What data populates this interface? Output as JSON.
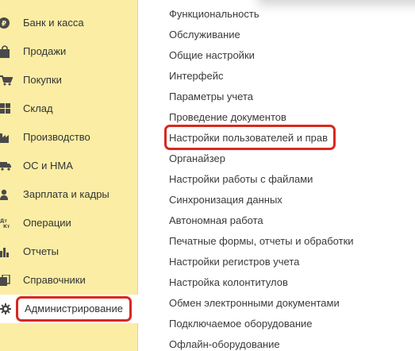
{
  "sidebar": {
    "items": [
      {
        "label": "Банк и касса",
        "icon": "coin-ruble-icon"
      },
      {
        "label": "Продажи",
        "icon": "shopping-bag-icon"
      },
      {
        "label": "Покупки",
        "icon": "shopping-cart-icon"
      },
      {
        "label": "Склад",
        "icon": "warehouse-grid-icon"
      },
      {
        "label": "Производство",
        "icon": "factory-icon"
      },
      {
        "label": "ОС и НМА",
        "icon": "truck-icon"
      },
      {
        "label": "Зарплата и кадры",
        "icon": "person-icon"
      },
      {
        "label": "Операции",
        "icon": "debit-credit-icon"
      },
      {
        "label": "Отчеты",
        "icon": "bar-chart-icon"
      },
      {
        "label": "Справочники",
        "icon": "books-icon"
      },
      {
        "label": "Администрирование",
        "icon": "gear-icon"
      }
    ],
    "active_label": "Администрирование"
  },
  "admin_menu": {
    "links": [
      "Функциональность",
      "Обслуживание",
      "Общие настройки",
      "Интерфейс",
      "Параметры учета",
      "Проведение документов",
      "Настройки пользователей и прав",
      "Органайзер",
      "Настройки работы с файлами",
      "Синхронизация данных",
      "Автономная работа",
      "Печатные формы, отчеты и обработки",
      "Настройки регистров учета",
      "Настройка колонтитулов",
      "Обмен электронными документами",
      "Подключаемое оборудование",
      "Офлайн-оборудование"
    ],
    "highlighted_link": "Настройки пользователей и прав"
  },
  "colors": {
    "sidebar_bg": "#fbeda4",
    "highlight_frame": "#d9281f",
    "icon": "#4a4a4a",
    "text": "#333333"
  }
}
